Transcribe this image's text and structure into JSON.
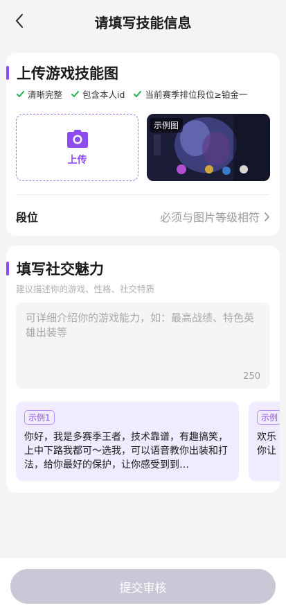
{
  "header": {
    "title": "请填写技能信息"
  },
  "upload_section": {
    "title": "上传游戏技能图",
    "checks": [
      "清晰完整",
      "包含本人id",
      "当前赛季排位段位≥铂金一"
    ],
    "upload_label": "上传",
    "sample_tag": "示例图",
    "rank_label": "段位",
    "rank_value": "必须与图片等级相符"
  },
  "social_section": {
    "title": "填写社交魅力",
    "subtitle": "建议描述你的游戏、性格、社交特质",
    "placeholder": "可详细介绍你的游戏能力，如：最高战绩、特色英雄出装等",
    "char_count": "250",
    "examples": [
      {
        "tag": "示例1",
        "text": "你好，我是多赛季王者，技术靠谱，有趣搞笑，上中下路我都可～选我，可以语音教你出装和打法，给你最好的保护，让你感受到到…"
      },
      {
        "tag": "示例",
        "text": "欢乐你让"
      }
    ]
  },
  "footer": {
    "submit_label": "提交审核"
  },
  "colors": {
    "accent": "#8e4cf0",
    "button_disabled": "#c9c8d6",
    "check_green": "#22b24c"
  }
}
